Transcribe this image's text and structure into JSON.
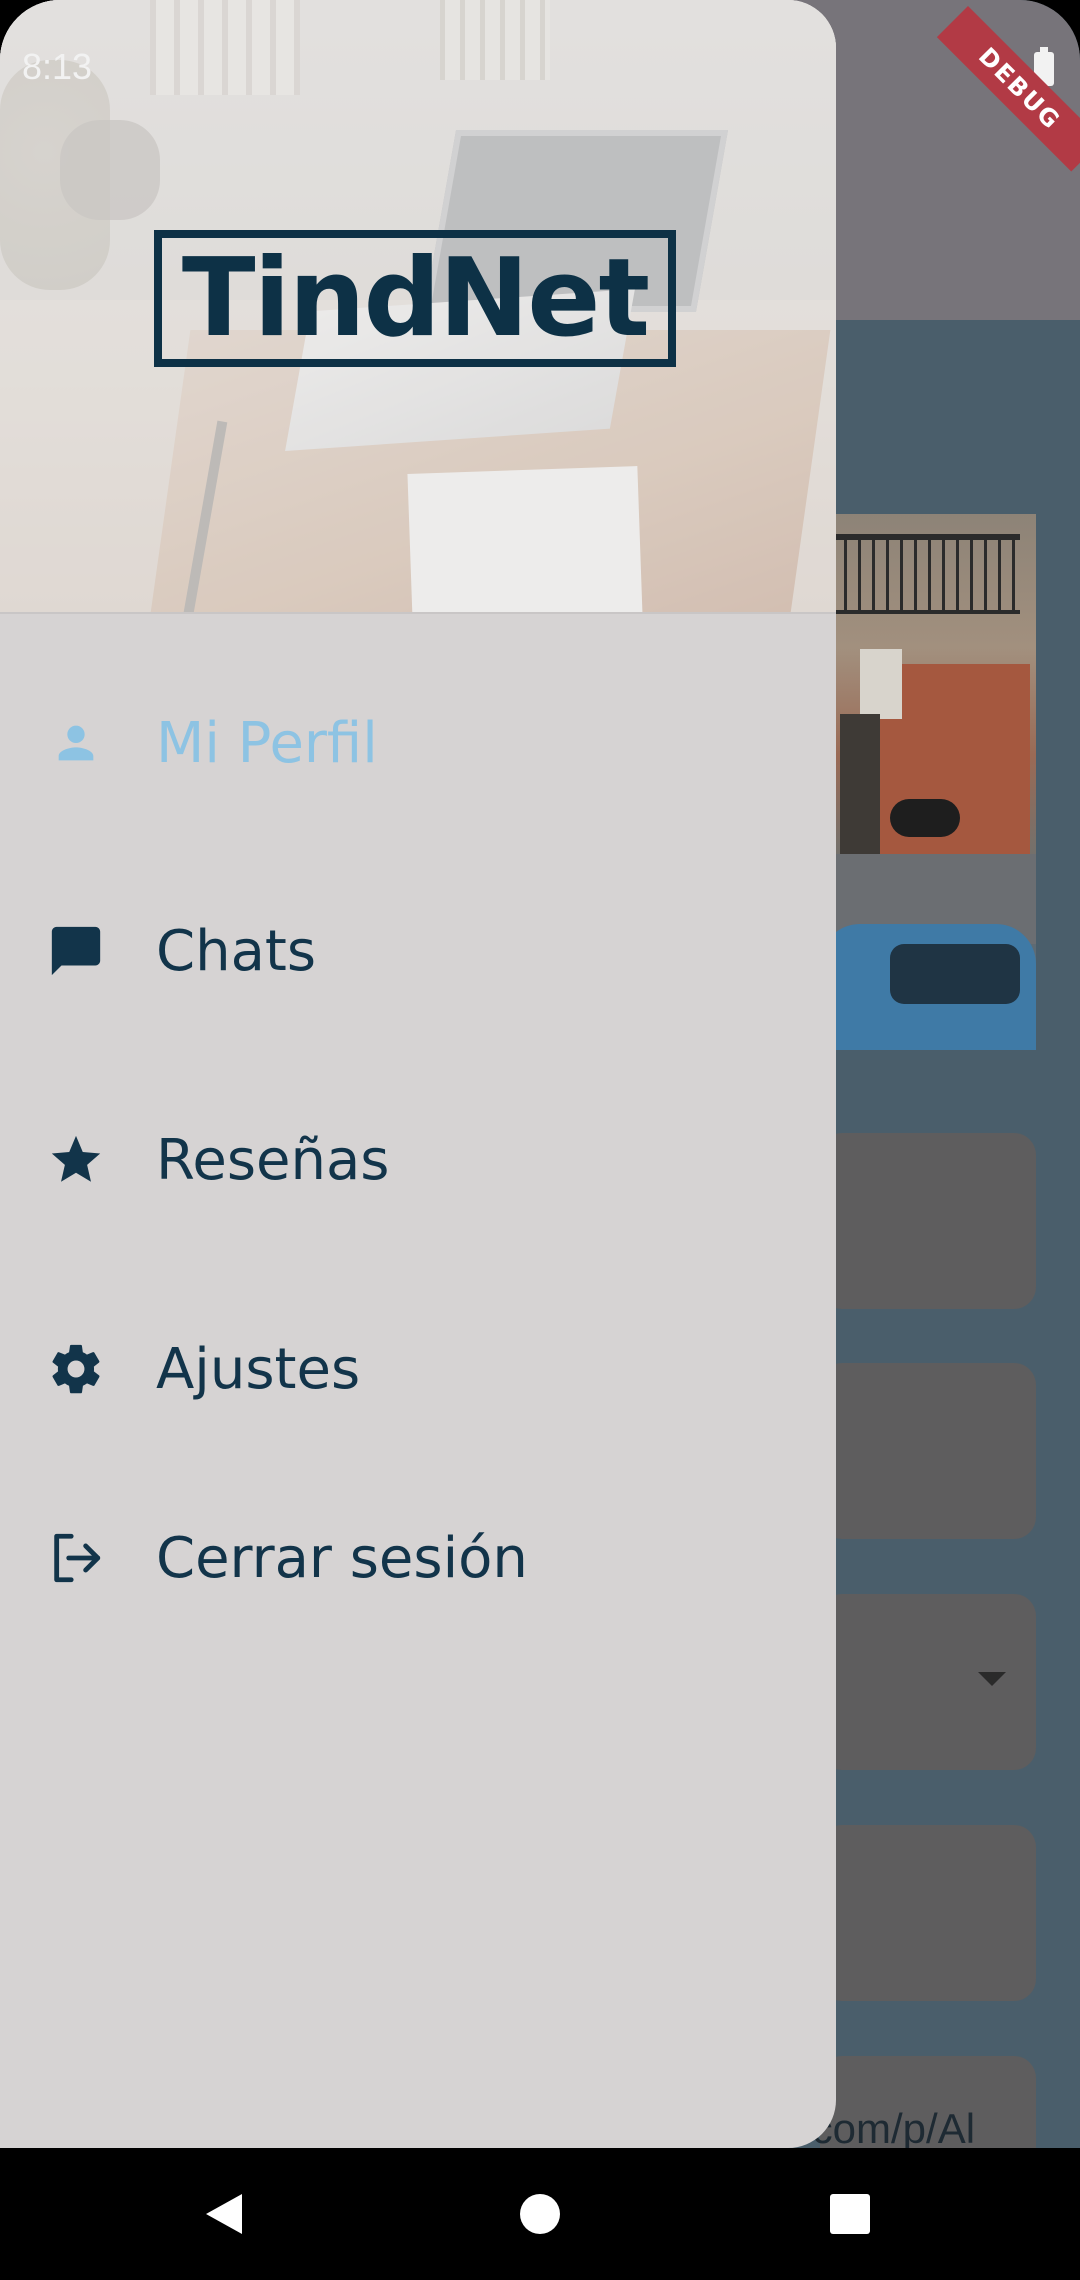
{
  "status_bar": {
    "time": "8:13",
    "debug_label": "DEBUG"
  },
  "app": {
    "logo_text": "TindNet"
  },
  "drawer": {
    "items": [
      {
        "label": "Mi Perfil",
        "icon": "person-icon",
        "active": true
      },
      {
        "label": "Chats",
        "icon": "chat-icon",
        "active": false
      },
      {
        "label": "Reseñas",
        "icon": "star-icon",
        "active": false
      },
      {
        "label": "Ajustes",
        "icon": "gear-icon",
        "active": false
      },
      {
        "label": "Cerrar sesión",
        "icon": "logout-icon",
        "active": false
      }
    ]
  },
  "background_page": {
    "url_fragment": ".com/p/Al"
  },
  "nav_bar": {
    "buttons": [
      "back",
      "home",
      "recent-apps"
    ]
  },
  "colors": {
    "accent": "#8dc3e3",
    "primary_text": "#12344a",
    "drawer_bg": "#d6d3d3",
    "logo": "#0d3146"
  }
}
